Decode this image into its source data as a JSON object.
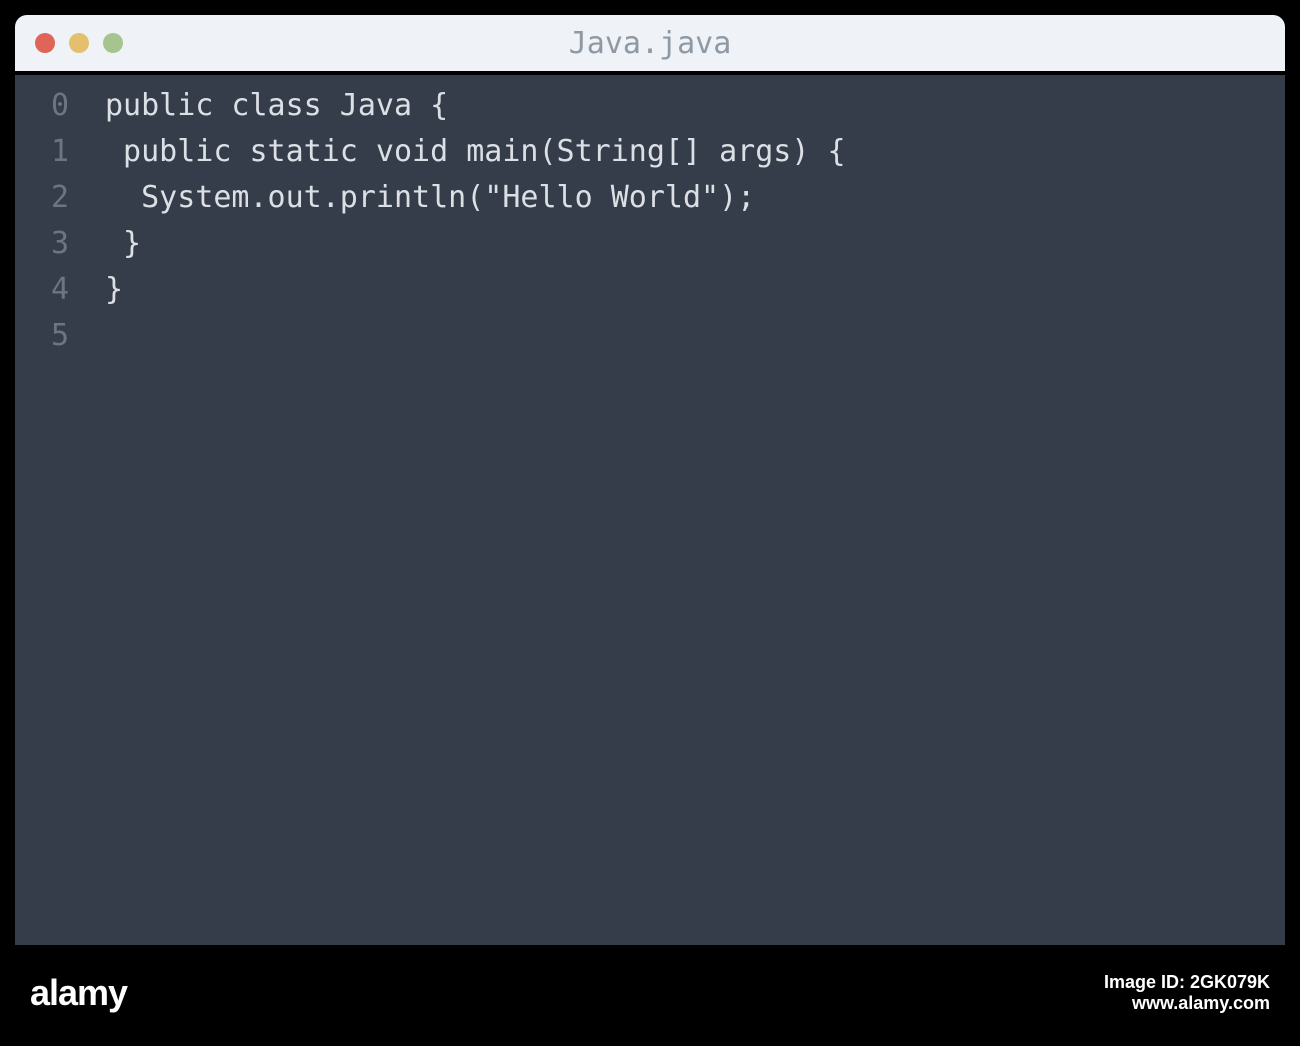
{
  "titlebar": {
    "filename": "Java.java"
  },
  "editor": {
    "lines": [
      {
        "number": "0",
        "code": "public class Java {"
      },
      {
        "number": "1",
        "code": " public static void main(String[] args) {"
      },
      {
        "number": "2",
        "code": "  System.out.println(\"Hello World\");"
      },
      {
        "number": "3",
        "code": " }"
      },
      {
        "number": "4",
        "code": "}"
      },
      {
        "number": "5",
        "code": ""
      }
    ]
  },
  "watermark": {
    "brand": "alamy",
    "sub1": "Image ID: 2GK079K",
    "sub2": "www.alamy.com"
  }
}
